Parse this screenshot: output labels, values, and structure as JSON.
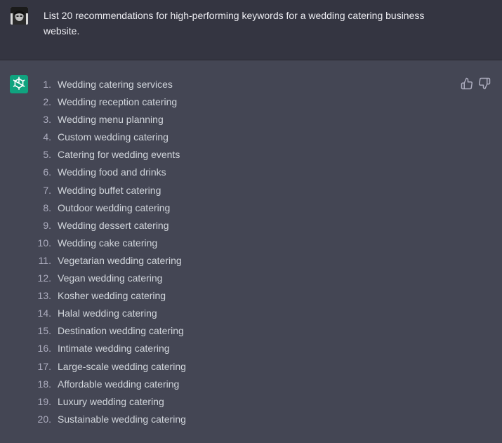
{
  "user_message": {
    "text": "List 20 recommendations for high-performing keywords for a wedding catering business website."
  },
  "assistant_message": {
    "items": [
      {
        "number": "1.",
        "text": "Wedding catering services"
      },
      {
        "number": "2.",
        "text": "Wedding reception catering"
      },
      {
        "number": "3.",
        "text": "Wedding menu planning"
      },
      {
        "number": "4.",
        "text": "Custom wedding catering"
      },
      {
        "number": "5.",
        "text": "Catering for wedding events"
      },
      {
        "number": "6.",
        "text": "Wedding food and drinks"
      },
      {
        "number": "7.",
        "text": "Wedding buffet catering"
      },
      {
        "number": "8.",
        "text": "Outdoor wedding catering"
      },
      {
        "number": "9.",
        "text": "Wedding dessert catering"
      },
      {
        "number": "10.",
        "text": "Wedding cake catering"
      },
      {
        "number": "11.",
        "text": "Vegetarian wedding catering"
      },
      {
        "number": "12.",
        "text": "Vegan wedding catering"
      },
      {
        "number": "13.",
        "text": "Kosher wedding catering"
      },
      {
        "number": "14.",
        "text": "Halal wedding catering"
      },
      {
        "number": "15.",
        "text": "Destination wedding catering"
      },
      {
        "number": "16.",
        "text": "Intimate wedding catering"
      },
      {
        "number": "17.",
        "text": "Large-scale wedding catering"
      },
      {
        "number": "18.",
        "text": "Affordable wedding catering"
      },
      {
        "number": "19.",
        "text": "Luxury wedding catering"
      },
      {
        "number": "20.",
        "text": "Sustainable wedding catering"
      }
    ]
  },
  "icons": {
    "user_avatar": "user-avatar-icon",
    "assistant_avatar": "openai-logo-icon",
    "thumbs_up": "thumbs-up-icon",
    "thumbs_down": "thumbs-down-icon"
  },
  "colors": {
    "user_row_bg": "#343541",
    "assistant_row_bg": "#444654",
    "assistant_avatar_bg": "#10a37f",
    "text": "#d1d5db"
  }
}
